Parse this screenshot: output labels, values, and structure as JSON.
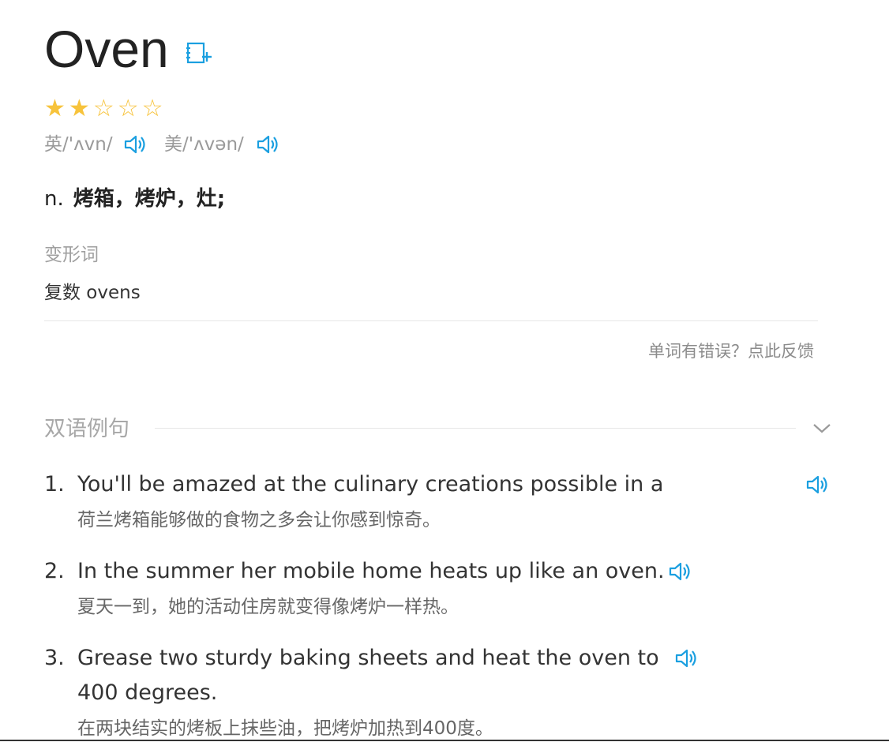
{
  "entry": {
    "word": "Oven",
    "rating": {
      "value": 2,
      "max": 5
    },
    "pronunciations": [
      {
        "label": "英",
        "ipa": "/'ʌvn/"
      },
      {
        "label": "美",
        "ipa": "/'ʌvən/"
      }
    ],
    "definition": {
      "pos": "n.",
      "meaning": "烤箱，烤炉，灶;"
    },
    "forms": {
      "label": "变形词",
      "value": "复数 ovens"
    },
    "feedback": "单词有错误？点此反馈"
  },
  "examples": {
    "title": "双语例句",
    "items": [
      {
        "num": "1.",
        "en": "You'll be amazed at the culinary creations possible in a",
        "zh": "荷兰烤箱能够做的食物之多会让你感到惊奇。"
      },
      {
        "num": "2.",
        "en": "In the summer her mobile home heats up like an oven.",
        "zh": "夏天一到，她的活动住房就变得像烤炉一样热。"
      },
      {
        "num": "3.",
        "en_line1": "Grease two sturdy baking sheets and heat the oven to",
        "en_line2": "400 degrees.",
        "zh": "在两块结实的烤板上抹些油，把烤炉加热到400度。"
      }
    ]
  },
  "icons": {
    "add": "add-to-wordbook-icon",
    "speaker": "speaker-icon",
    "chevron": "chevron-down-icon",
    "star": "star-icon"
  },
  "colors": {
    "accent": "#1a9fe0",
    "star": "#f7c33b"
  }
}
